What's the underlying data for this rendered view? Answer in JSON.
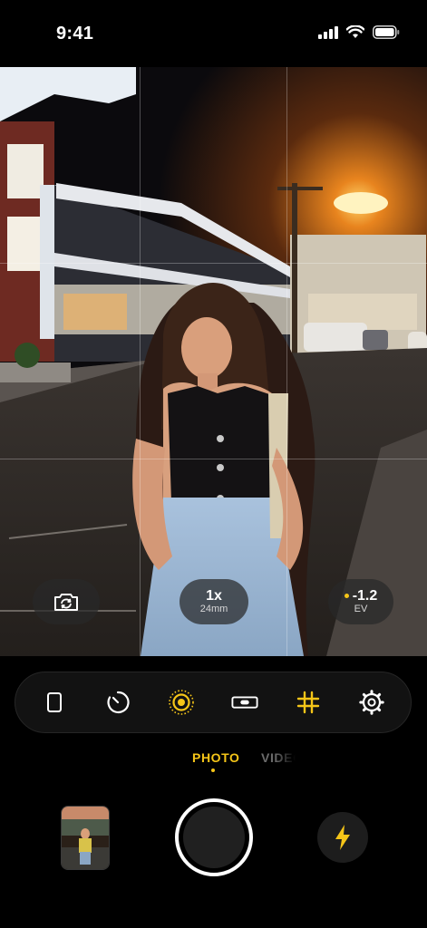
{
  "status_bar": {
    "time": "9:41",
    "icons": [
      "cellular-signal-icon",
      "wifi-icon",
      "battery-icon"
    ]
  },
  "viewfinder": {
    "grid": "on",
    "flip_camera_icon": "camera-rotate-icon",
    "zoom": {
      "value": "1x",
      "focal_length": "24mm"
    },
    "exposure": {
      "value": "-1.2",
      "unit": "EV"
    }
  },
  "toolbar": {
    "tools": [
      "aspect-ratio-icon",
      "timer-icon",
      "live-photo-icon",
      "level-icon",
      "grid-icon",
      "settings-gear-icon"
    ],
    "active_color": "#f5c518"
  },
  "modes": {
    "photo": "PHOTO",
    "video": "VIDEO",
    "selected": "PHOTO"
  },
  "bottom": {
    "last_photo": "thumbnail-image",
    "shutter": "shutter-button",
    "flash_icon": "flash-icon"
  },
  "colors": {
    "accent": "#f5c518",
    "background": "#000000"
  }
}
